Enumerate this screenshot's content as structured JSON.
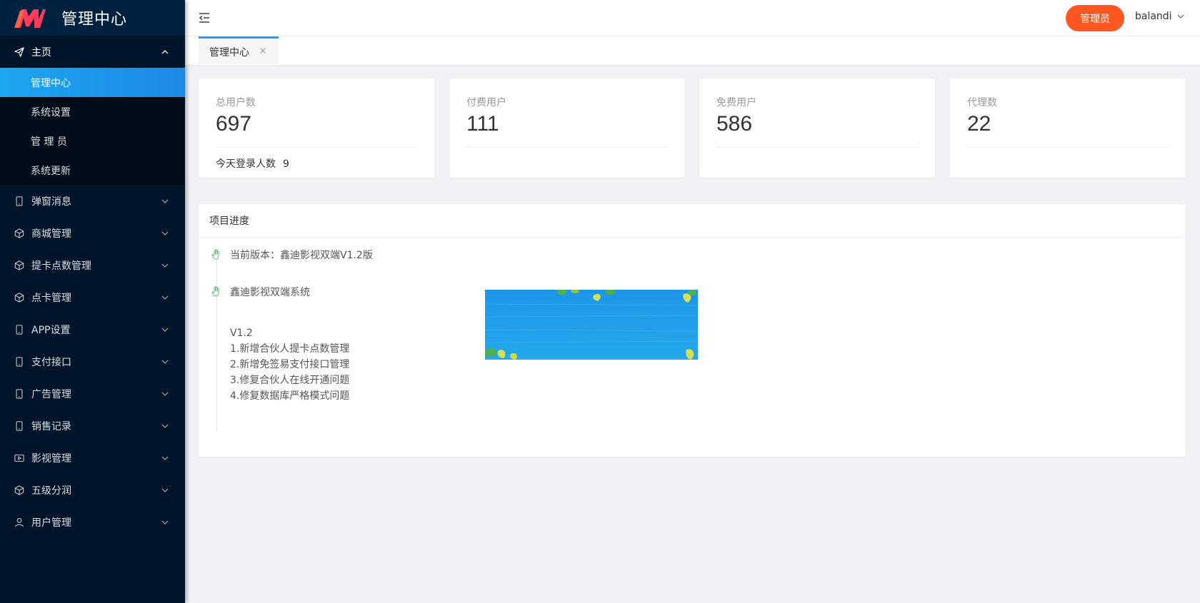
{
  "app": {
    "logo_text": "管理中心"
  },
  "sidebar": {
    "home": {
      "label": "主页",
      "icon": "send-icon"
    },
    "home_children": [
      {
        "label": "管理中心",
        "active": true
      },
      {
        "label": "系统设置",
        "active": false
      },
      {
        "label": "管 理 员",
        "active": false
      },
      {
        "label": "系统更新",
        "active": false
      }
    ],
    "items": [
      {
        "label": "弹窗消息",
        "icon": "phone-icon"
      },
      {
        "label": "商城管理",
        "icon": "cube-icon"
      },
      {
        "label": "提卡点数管理",
        "icon": "cube-icon"
      },
      {
        "label": "点卡管理",
        "icon": "cube-icon"
      },
      {
        "label": "APP设置",
        "icon": "phone-icon"
      },
      {
        "label": "支付接口",
        "icon": "phone-icon"
      },
      {
        "label": "广告管理",
        "icon": "phone-icon"
      },
      {
        "label": "销售记录",
        "icon": "phone-icon"
      },
      {
        "label": "影视管理",
        "icon": "video-icon"
      },
      {
        "label": "五级分润",
        "icon": "cube-icon"
      },
      {
        "label": "用户管理",
        "icon": "user-icon"
      }
    ]
  },
  "header": {
    "admin_button": "管理员",
    "username": "balandi"
  },
  "tabs": [
    {
      "label": "管理中心"
    }
  ],
  "stats": [
    {
      "label": "总用户数",
      "value": "697",
      "extra_label": "今天登录人数",
      "extra_value": "9"
    },
    {
      "label": "付费用户",
      "value": "111"
    },
    {
      "label": "免费用户",
      "value": "586"
    },
    {
      "label": "代理数",
      "value": "22"
    }
  ],
  "progress": {
    "title": "项目进度",
    "entries": [
      {
        "title": "当前版本：鑫迪影视双端V1.2版"
      },
      {
        "title": "鑫迪影视双端系统",
        "version": "V1.2",
        "changes": [
          "1.新增合伙人提卡点数管理",
          "2.新增免签易支付接口管理",
          "3.修复合伙人在线开通问题",
          "4.修复数据库严格模式问题"
        ]
      }
    ]
  },
  "colors": {
    "sidebar_bg": "#001529",
    "active_item": "#1e9fff",
    "admin_button": "#ff5722",
    "page_bg": "#f0f2f5"
  }
}
